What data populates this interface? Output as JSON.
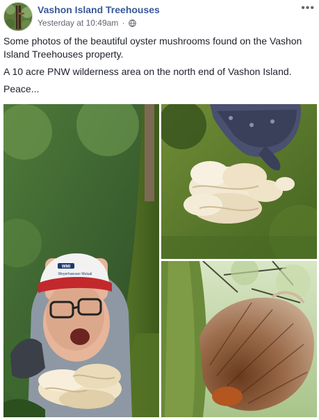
{
  "header": {
    "page_name": "Vashon Island Treehouses",
    "timestamp": "Yesterday at 10:49am",
    "separator": "·",
    "privacy_icon": "globe-icon",
    "more_label": "•••",
    "avatar_icon": "tree-avatar"
  },
  "post": {
    "paragraphs": [
      "Some photos of the beautiful oyster mushrooms found on the Vashon Island Treehouses property.",
      "A 10 acre PNW wilderness area on the north end of Vashon Island.",
      "Peace..."
    ]
  },
  "photos": {
    "left_hat_text": "Weyerhaeuser Mutual",
    "brand_mark": "WMI"
  },
  "colors": {
    "link": "#385898",
    "text": "#1d2129",
    "meta": "#616770"
  }
}
